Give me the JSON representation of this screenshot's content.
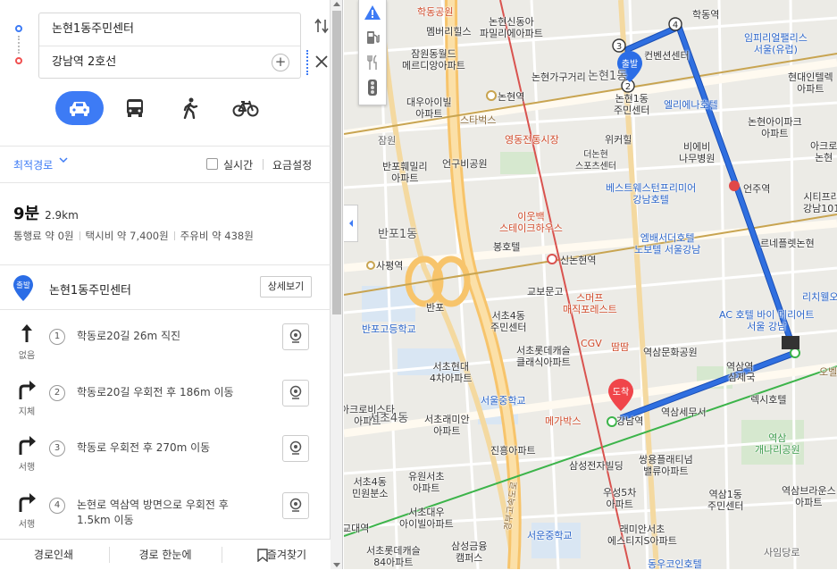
{
  "route": {
    "origin": "논현1동주민센터",
    "destination": "강남역 2호선"
  },
  "modes": [
    {
      "name": "car",
      "active": true
    },
    {
      "name": "bus",
      "active": false
    },
    {
      "name": "walk",
      "active": false
    },
    {
      "name": "bike",
      "active": false
    }
  ],
  "options": {
    "best_route": "최적경로",
    "realtime": "실시간",
    "fee_settings": "요금설정"
  },
  "summary": {
    "time": "9분",
    "distance": "2.9km",
    "toll": "통행료 약 0원",
    "taxi": "택시비 약 7,400원",
    "fuel": "주유비 약 438원"
  },
  "start": {
    "badge": "출발",
    "name": "논현1동주민센터",
    "detail_button": "상세보기"
  },
  "steps": [
    {
      "num": "1",
      "direction": "straight",
      "dir_label": "없음",
      "text": "학동로20길 26m 직진"
    },
    {
      "num": "2",
      "direction": "right",
      "dir_label": "지체",
      "text": "학동로20길 우회전 후 186m 이동"
    },
    {
      "num": "3",
      "direction": "right",
      "dir_label": "서행",
      "text": "학동로 우회전 후 270m 이동"
    },
    {
      "num": "4",
      "direction": "right",
      "dir_label": "서행",
      "text": "논현로 역삼역 방면으로 우회전 후 1.5km 이동"
    }
  ],
  "footer": {
    "print": "경로인쇄",
    "overview": "경로 한눈에",
    "favorite": "즐겨찾기"
  },
  "map": {
    "route_color": "#2f6fe0",
    "start_badge": "출발",
    "end_badge": "도착",
    "waypoints": [
      "2",
      "3",
      "4"
    ],
    "labels": {
      "l1": "학동공원",
      "l2": "논현신동아\n파밀리에아파트",
      "l3": "학동역",
      "l4": "멤버리힐스",
      "l5": "잠원동월드\n메르디앙아파트",
      "l6": "논현가구거리",
      "l7": "논현1동",
      "l8": "논현1동\n주민센터",
      "l9": "컨벤션센터",
      "l10": "임피리얼팰리스\n서울(유럽)",
      "l11": "현대인텔렉\n아파트",
      "l12": "대우아이빌\n아파트",
      "l13": "논현역",
      "l14": "스타벅스",
      "l15": "영동전통시장",
      "l16": "엘리에나호텔",
      "l17": "논현아이파크\n아파트",
      "l18": "잠원",
      "l19": "반포훼밀리\n아파트",
      "l20": "언구비공원",
      "l21": "더논현\n스포츠센터",
      "l22": "위커힐",
      "l23": "비에비\n나무병원",
      "l24": "아크로\n논현",
      "l25": "베스트웨스턴프리미어\n강남호텔",
      "l26": "언주역",
      "l27": "시티프라\n강남101",
      "l28": "반포1동",
      "l29": "이웃백\n스테이크하우스",
      "l30": "봉호텔",
      "l31": "엠배서더호텔\n노보텔 서울강남",
      "l32": "르네플렛논현",
      "l33": "사평역",
      "l34": "신논현역",
      "l35": "교보문고",
      "l36": "스머프\n매직포레스트",
      "l37": "리치웰오",
      "l38": "반포",
      "l39": "서초4동\n주민센터",
      "l40": "AC 호텔 바이 메리어트\n서울 강남",
      "l41": "반포고등학교",
      "l42": "CGV",
      "l43": "땀땀",
      "l44": "역삼문화공원",
      "l45": "서초롯데캐슬\n클래식아파트",
      "l46": "서초현대\n4차아파트",
      "l47": "역삼역",
      "l48": "오벨",
      "l49": "삼제국",
      "l50": "렉시호텔",
      "l51": "서울중학교",
      "l52": "메가박스",
      "l53": "강남역",
      "l54": "역삼세무서",
      "l55": "아크로비스타\n아파트",
      "l56": "서초4동",
      "l57": "서초래미안\n아파트",
      "l58": "진흥아파트",
      "l59": "역삼\n개나리공원",
      "l60": "삼성전자빌딩",
      "l61": "쌍용플래티넘\n밸류아파트",
      "l62": "서초4동\n민원분소",
      "l63": "유원서초\n아파트",
      "l64": "우성5차\n아파트",
      "l65": "역삼1동\n주민센터",
      "l66": "역삼브라운스\n아파트",
      "l67": "서초대우\n아이빌아파트",
      "l68": "교대역",
      "l69": "서초롯데캐슬\n84아파트",
      "l70": "삼성금융\n캠퍼스",
      "l71": "서운중학교",
      "l72": "래미안서초\n에스티지S아파트",
      "l73": "사임당로",
      "l74": "동우코인호텔",
      "l75": "경부고속도로"
    }
  }
}
